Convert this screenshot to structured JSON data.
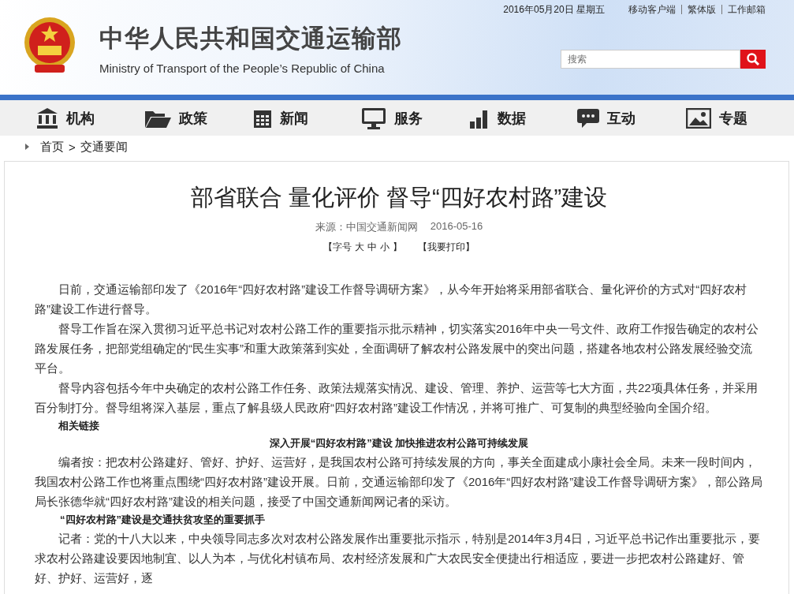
{
  "top_bar": {
    "date": "2016年05月20日  星期五",
    "links": [
      "移动客户端",
      "繁体版",
      "工作邮箱"
    ]
  },
  "header": {
    "title": "中华人民共和国交通运输部",
    "subtitle": "Ministry of Transport of the People’s Republic of China",
    "search": {
      "placeholder": "搜索"
    }
  },
  "nav": [
    {
      "label": "机构",
      "kind": "building"
    },
    {
      "label": "政策",
      "kind": "folder"
    },
    {
      "label": "新闻",
      "kind": "calendar"
    },
    {
      "label": "服务",
      "kind": "monitor"
    },
    {
      "label": "数据",
      "kind": "bars"
    },
    {
      "label": "互动",
      "kind": "chat"
    },
    {
      "label": "专题",
      "kind": "image"
    }
  ],
  "breadcrumb": [
    "首页",
    "交通要闻"
  ],
  "breadcrumb_separator": ">",
  "article": {
    "title": "部省联合 量化评价 督导“四好农村路”建设",
    "source": "来源：中国交通新闻网",
    "date": "2016-05-16",
    "font_size_label": "【字号",
    "font_sizes": [
      "大",
      "中",
      "小"
    ],
    "font_size_end": "】",
    "print": "【我要打印】",
    "blocks": [
      {
        "kind": "para",
        "text": "日前，交通运输部印发了《2016年“四好农村路”建设工作督导调研方案》，从今年开始将采用部省联合、量化评价的方式对“四好农村路”建设工作进行督导。"
      },
      {
        "kind": "para",
        "text": "督导工作旨在深入贯彻习近平总书记对农村公路工作的重要指示批示精神，切实落实2016年中央一号文件、政府工作报告确定的农村公路发展任务，把部党组确定的“民生实事”和重大政策落到实处，全面调研了解农村公路发展中的突出问题，搭建各地农村公路发展经验交流平台。"
      },
      {
        "kind": "para",
        "text": "督导内容包括今年中央确定的农村公路工作任务、政策法规落实情况、建设、管理、养护、运营等七大方面，共22项具体任务，并采用百分制打分。督导组将深入基层，重点了解县级人民政府“四好农村路”建设工作情况，并将可推广、可复制的典型经验向全国介绍。"
      },
      {
        "kind": "label",
        "text": "相关链接"
      },
      {
        "kind": "heading",
        "text": "深入开展“四好农村路”建设 加快推进农村公路可持续发展"
      },
      {
        "kind": "para",
        "text": "编者按：把农村公路建好、管好、护好、运营好，是我国农村公路可持续发展的方向，事关全面建成小康社会全局。未来一段时间内，我国农村公路工作也将重点围绕“四好农村路”建设开展。日前，交通运输部印发了《2016年“四好农村路”建设工作督导调研方案》，部公路局局长张德华就“四好农村路”建设的相关问题，接受了中国交通新闻网记者的采访。"
      },
      {
        "kind": "subheading",
        "text": "“四好农村路”建设是交通扶贫攻坚的重要抓手"
      },
      {
        "kind": "para",
        "text": "记者：党的十八大以来，中央领导同志多次对农村公路发展作出重要批示指示，特别是2014年3月4日，习近平总书记作出重要批示，要求农村公路建设要因地制宜、以人为本，与优化村镇布局、农村经济发展和广大农民安全便捷出行相适应，要进一步把农村公路建好、管好、护好、运营好，逐"
      }
    ]
  }
}
